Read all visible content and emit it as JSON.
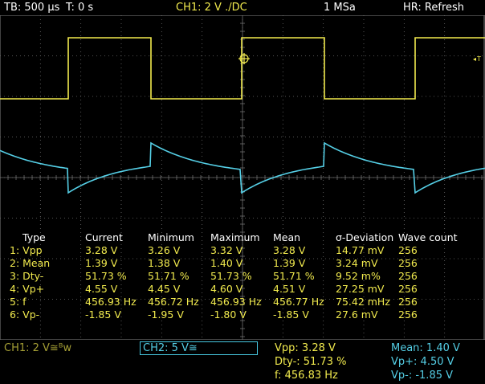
{
  "status_bar": {
    "timebase": "TB: 500 µs",
    "trigger_time": "T: 0 s",
    "ch1_setting": "CH1: 2 V ./DC",
    "sample_rate": "1 MSa",
    "hr_mode": "HR: Refresh"
  },
  "colors": {
    "ch1": "#f2eb4e",
    "ch2": "#55cfe6",
    "grid": "#6e6e6e",
    "ch1_dim": "#a59f35",
    "ch2_box": "#47c7e0"
  },
  "trigger_marker": "T",
  "measurements": {
    "headers": [
      "Type",
      "Current",
      "Minimum",
      "Maximum",
      "Mean",
      "σ-Deviation",
      "Wave count"
    ],
    "rows": [
      {
        "type": "1: Vpp",
        "current": "3.28 V",
        "minimum": "3.26 V",
        "maximum": "3.32 V",
        "mean": "3.28 V",
        "sigma": "14.77 mV",
        "count": "256"
      },
      {
        "type": "2: Mean",
        "current": "1.39 V",
        "minimum": "1.38 V",
        "maximum": "1.40 V",
        "mean": "1.39 V",
        "sigma": "3.24 mV",
        "count": "256"
      },
      {
        "type": "3: Dty-",
        "current": "51.73 %",
        "minimum": "51.71 %",
        "maximum": "51.73 %",
        "mean": "51.71 %",
        "sigma": "9.52 m%",
        "count": "256"
      },
      {
        "type": "4: Vp+",
        "current": "4.55 V",
        "minimum": "4.45 V",
        "maximum": "4.60 V",
        "mean": "4.51 V",
        "sigma": "27.25 mV",
        "count": "256"
      },
      {
        "type": "5: f",
        "current": "456.93 Hz",
        "minimum": "456.72 Hz",
        "maximum": "456.93 Hz",
        "mean": "456.77 Hz",
        "sigma": "75.42 mHz",
        "count": "256"
      },
      {
        "type": "6: Vp-",
        "current": "-1.85 V",
        "minimum": "-1.95 V",
        "maximum": "-1.80 V",
        "mean": "-1.85 V",
        "sigma": "27.6 mV",
        "count": "256"
      }
    ]
  },
  "bottom_bar": {
    "ch1_label": "CH1: 2 V≅ᴮᴡ",
    "ch2_label": "CH2: 5 V≅",
    "vpp": "Vpp: 3.28 V",
    "dty": "Dty-: 51.73 %",
    "freq": "f: 456.83 Hz",
    "mean": "Mean: 1.40 V",
    "vp_plus": "Vp+: 4.50 V",
    "vp_minus": "Vp-: -1.85 V"
  }
}
